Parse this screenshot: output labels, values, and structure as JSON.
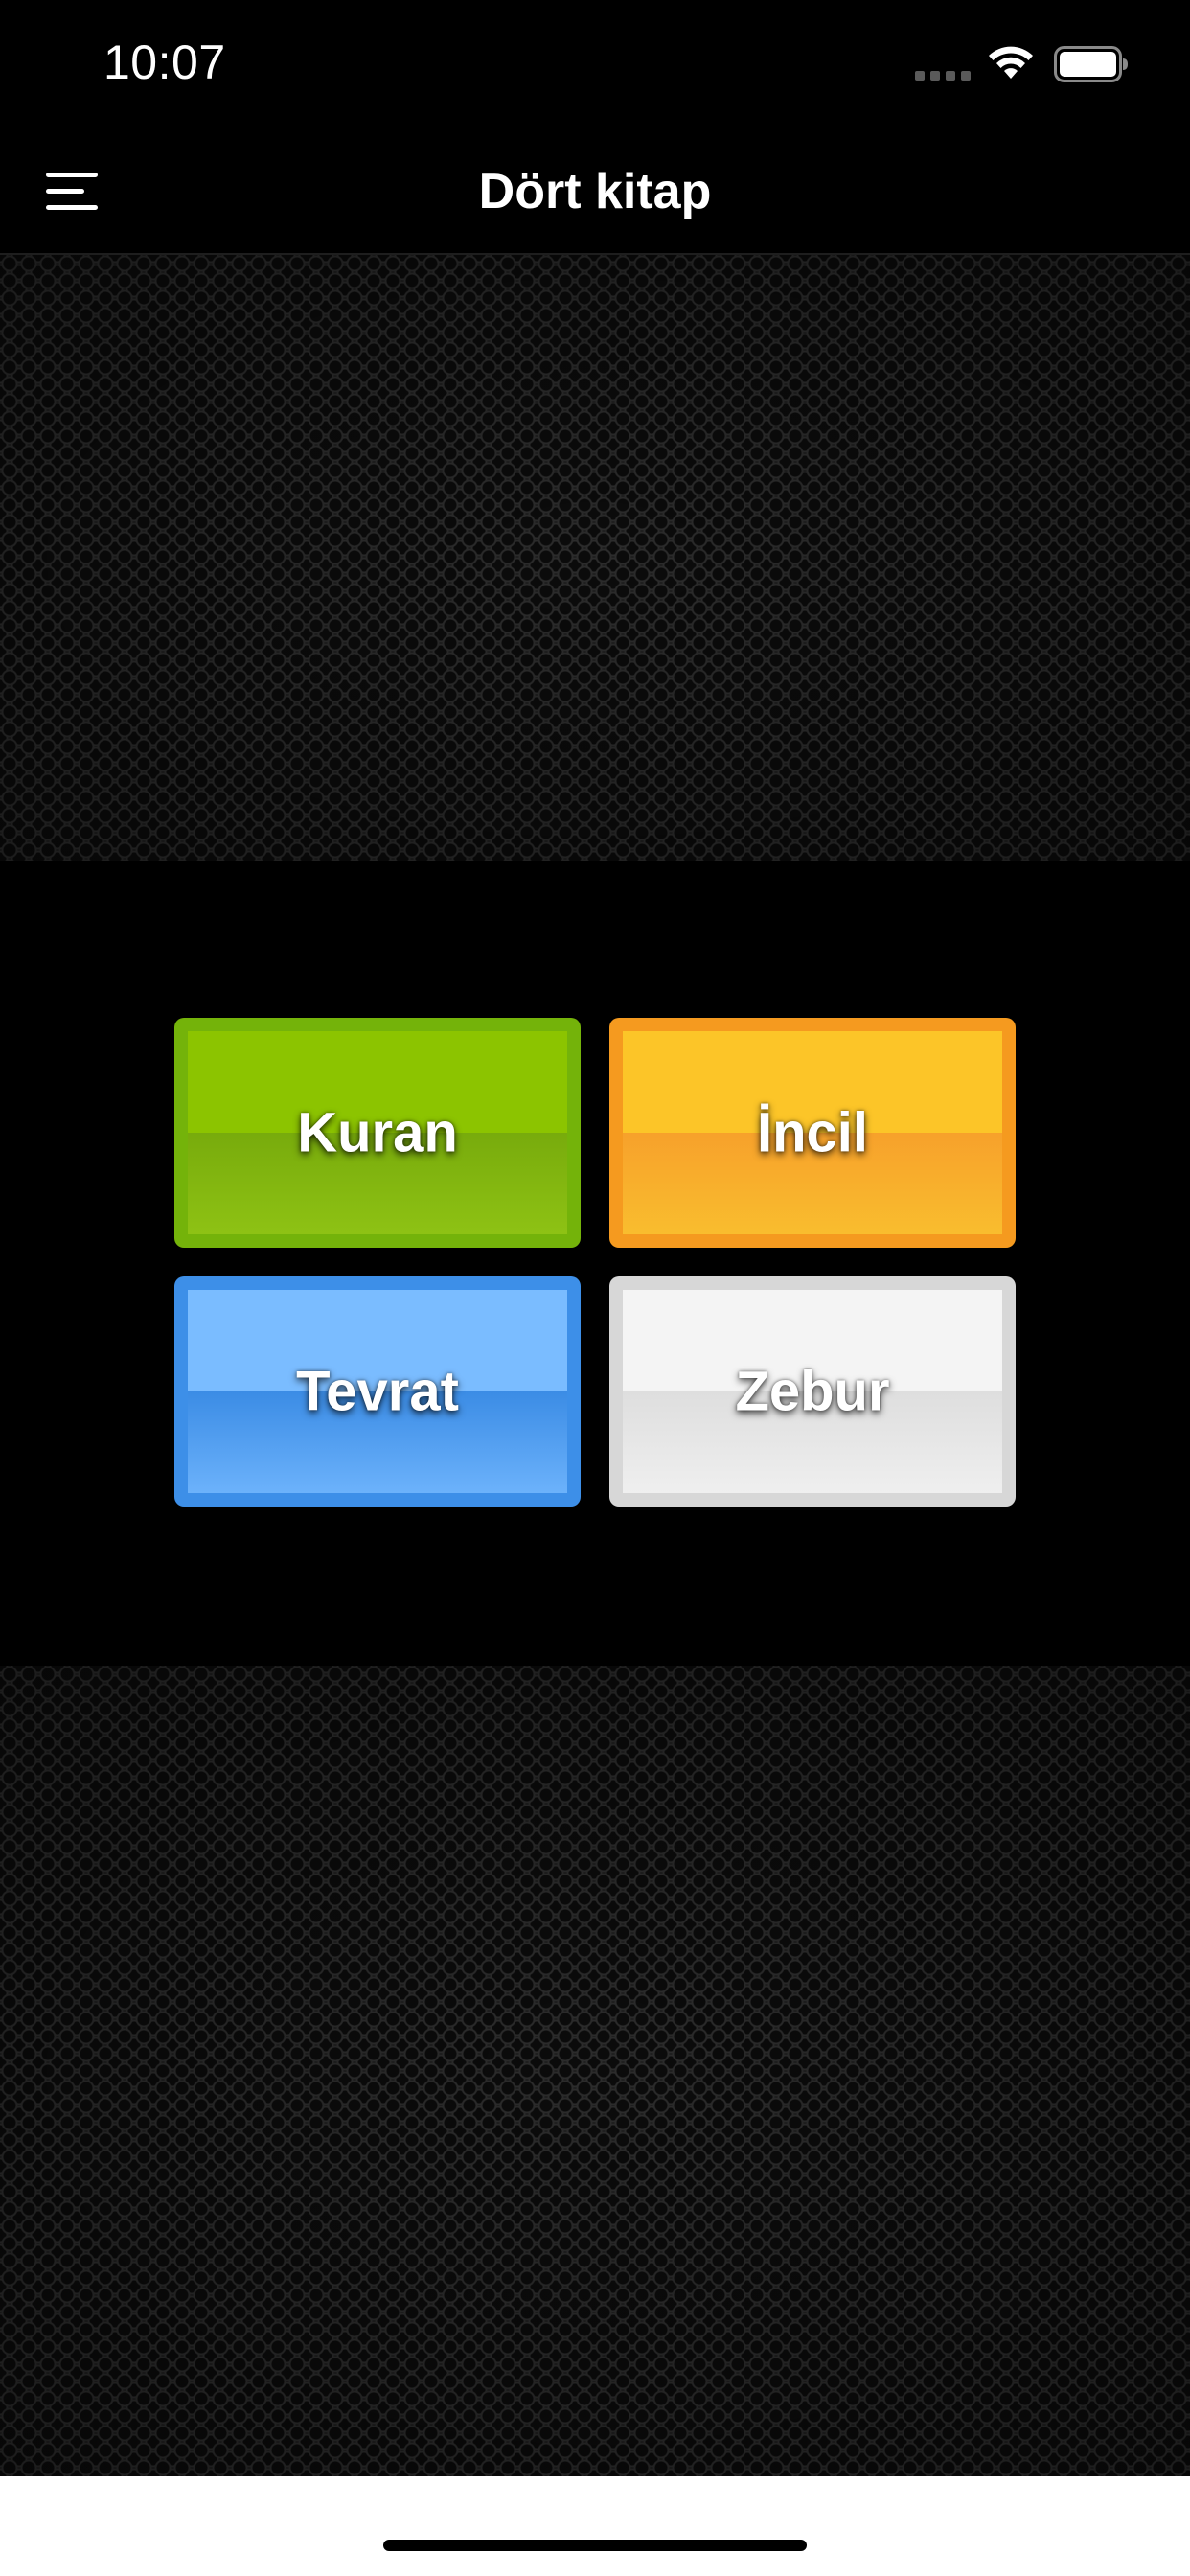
{
  "status_bar": {
    "time": "10:07",
    "icons": [
      "signal-icon",
      "wifi-icon",
      "battery-icon"
    ]
  },
  "nav": {
    "title": "Dört kitap",
    "menu_icon": "hamburger-menu-icon"
  },
  "books": [
    {
      "label": "Kuran",
      "color": "#8cc400"
    },
    {
      "label": "İncil",
      "color": "#fcc528"
    },
    {
      "label": "Tevrat",
      "color": "#7abcff"
    },
    {
      "label": "Zebur",
      "color": "#f4f4f4"
    }
  ],
  "colors": {
    "background": "#000000",
    "nav_text": "#ffffff",
    "home_area": "#ffffff"
  }
}
